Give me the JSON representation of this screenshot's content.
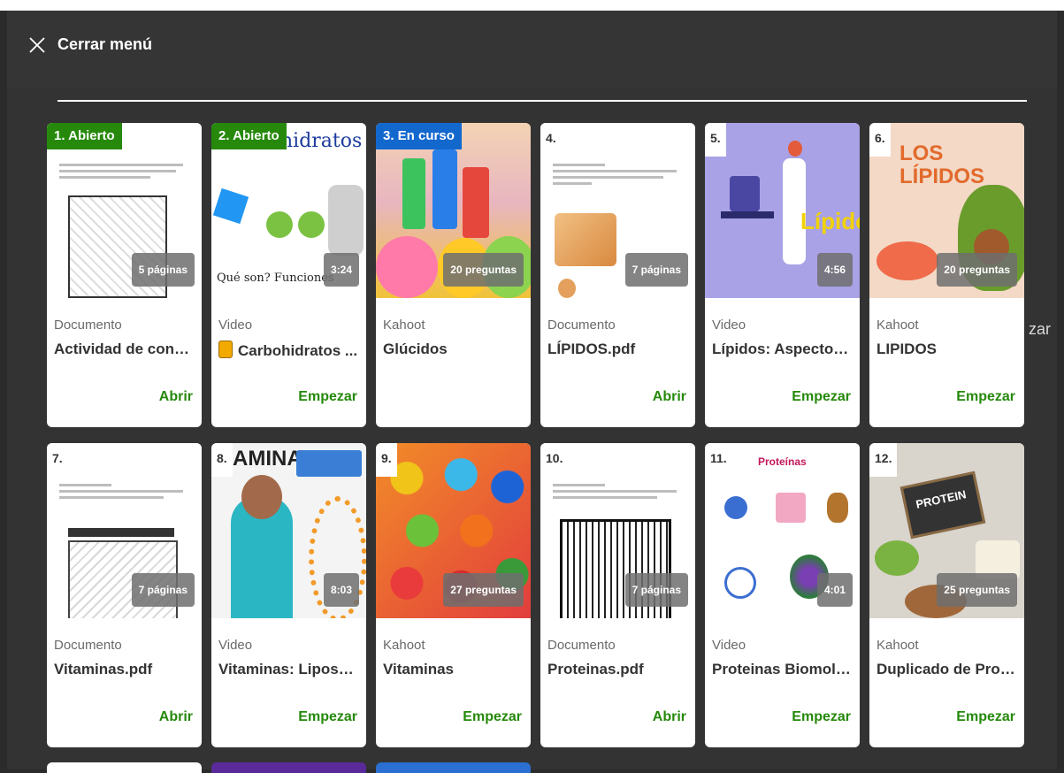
{
  "header": {
    "close_label": "Cerrar menú"
  },
  "edge_text": "zar",
  "cards": [
    {
      "badge": "1. Abierto",
      "badge_kind": "open",
      "duration": "5 páginas",
      "type": "Documento",
      "title": "Actividad de conoci...",
      "action": "Abrir",
      "thumb_text": ""
    },
    {
      "badge": "2. Abierto",
      "badge_kind": "open",
      "duration": "3:24",
      "type": "Video",
      "title": "Carbohidratos ...",
      "action": "Empezar",
      "thumb_text": "hidratos"
    },
    {
      "badge": "3. En curso",
      "badge_kind": "progress",
      "duration": "20 preguntas",
      "type": "Kahoot",
      "title": "Glúcidos",
      "action": "",
      "thumb_text": ""
    },
    {
      "badge": "4.",
      "badge_kind": "num",
      "duration": "7 páginas",
      "type": "Documento",
      "title": "LÍPIDOS.pdf",
      "action": "Abrir",
      "thumb_text": ""
    },
    {
      "badge": "5.",
      "badge_kind": "num",
      "duration": "4:56",
      "type": "Video",
      "title": "Lípidos: Aspectos g...",
      "action": "Empezar",
      "thumb_text": "Lípidos"
    },
    {
      "badge": "6.",
      "badge_kind": "num",
      "duration": "20 preguntas",
      "type": "Kahoot",
      "title": "LIPIDOS",
      "action": "Empezar",
      "thumb_text": "LOS LÍPIDOS"
    },
    {
      "badge": "7.",
      "badge_kind": "num",
      "duration": "7 páginas",
      "type": "Documento",
      "title": "Vitaminas.pdf",
      "action": "Abrir",
      "thumb_text": ""
    },
    {
      "badge": "8.",
      "badge_kind": "num",
      "duration": "8:03",
      "type": "Video",
      "title": "Vitaminas: Liposolu...",
      "action": "Empezar",
      "thumb_text": "AMINAS"
    },
    {
      "badge": "9.",
      "badge_kind": "num",
      "duration": "27 preguntas",
      "type": "Kahoot",
      "title": "Vitaminas",
      "action": "Empezar",
      "thumb_text": ""
    },
    {
      "badge": "10.",
      "badge_kind": "num",
      "duration": "7 páginas",
      "type": "Documento",
      "title": "Proteinas.pdf",
      "action": "Abrir",
      "thumb_text": ""
    },
    {
      "badge": "11.",
      "badge_kind": "num",
      "duration": "4:01",
      "type": "Video",
      "title": "Proteinas Biomoléc...",
      "action": "Empezar",
      "thumb_text": "Proteínas"
    },
    {
      "badge": "12.",
      "badge_kind": "num",
      "duration": "25 preguntas",
      "type": "Kahoot",
      "title": "Duplicado de Protei...",
      "action": "Empezar",
      "thumb_text": "PROTEIN"
    }
  ],
  "colors": {
    "open": "#26890c",
    "progress": "#1368ce",
    "action": "#26890c"
  }
}
